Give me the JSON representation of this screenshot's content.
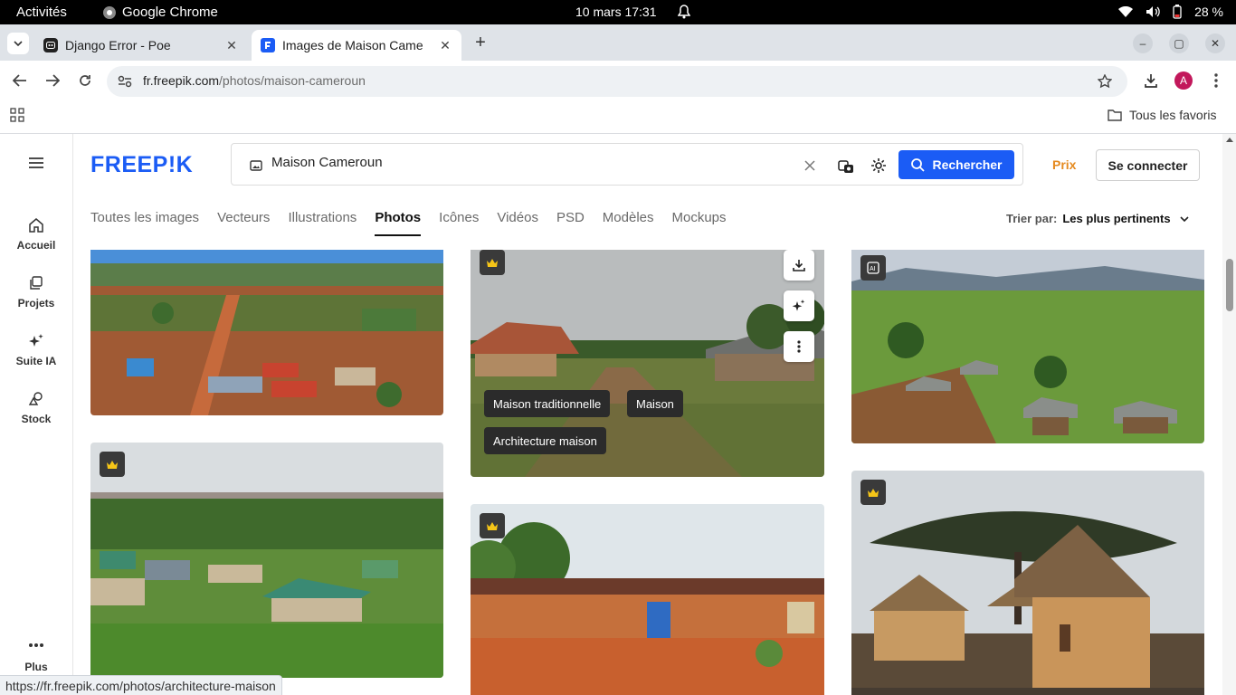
{
  "os": {
    "activities": "Activités",
    "app": "Google Chrome",
    "clock": "10 mars  17:31",
    "battery": "28 %"
  },
  "tabs": [
    {
      "title": "Django Error - Poe"
    },
    {
      "title": "Images de Maison Came"
    }
  ],
  "address": {
    "domain": "fr.freepik.com",
    "path": "/photos/maison-cameroun",
    "avatar": "A"
  },
  "bookmarks": {
    "all": "Tous les favoris"
  },
  "sidebar": {
    "items": [
      {
        "label": "Accueil"
      },
      {
        "label": "Projets"
      },
      {
        "label": "Suite IA"
      },
      {
        "label": "Stock"
      }
    ],
    "more": "Plus"
  },
  "header": {
    "logo": "FREEP!K",
    "search_value": "Maison Cameroun",
    "search_button": "Rechercher",
    "prix": "Prix",
    "login": "Se connecter"
  },
  "categories": [
    "Toutes les images",
    "Vecteurs",
    "Illustrations",
    "Photos",
    "Icônes",
    "Vidéos",
    "PSD",
    "Modèles",
    "Mockups"
  ],
  "sort": {
    "label": "Trier par:",
    "value": "Les plus pertinents"
  },
  "hover_tags": [
    "Maison traditionnelle",
    "Maison",
    "Architecture maison"
  ],
  "status_url": "https://fr.freepik.com/photos/architecture-maison",
  "colors": {
    "brand": "#1b5cf5",
    "prix": "#e58a1f"
  }
}
